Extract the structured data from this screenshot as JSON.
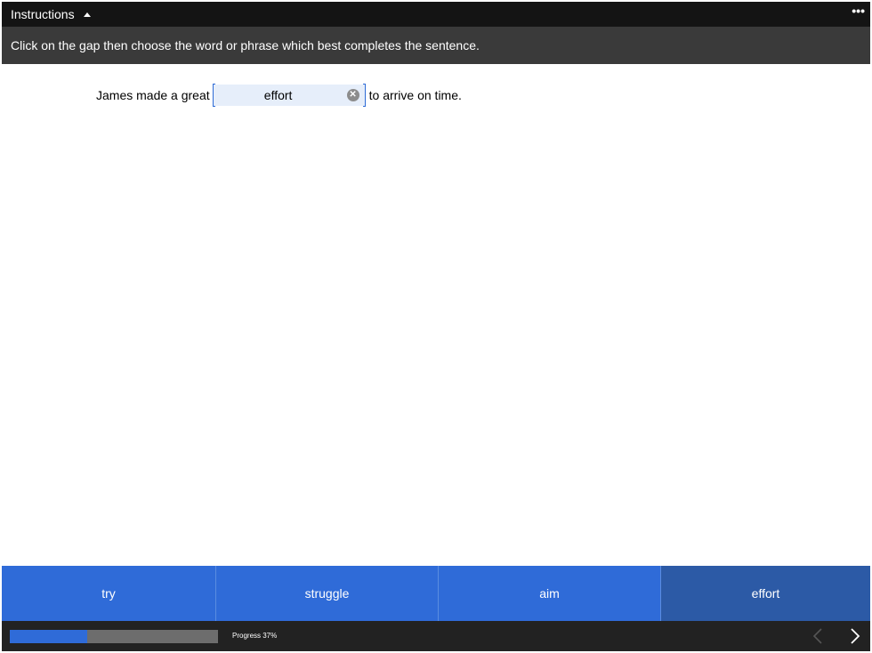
{
  "header": {
    "instructions_label": "Instructions",
    "more_label": "•••"
  },
  "instructions": {
    "text": "Click on the gap then choose the word or phrase which best completes the sentence."
  },
  "question": {
    "before": "James made a great",
    "gap_value": "effort",
    "after": "to arrive on time."
  },
  "options": [
    {
      "label": "try",
      "used": false
    },
    {
      "label": "struggle",
      "used": false
    },
    {
      "label": "aim",
      "used": false
    },
    {
      "label": "effort",
      "used": true
    }
  ],
  "footer": {
    "progress_label": "Progress 37%",
    "progress_fraction": 0.37
  },
  "colors": {
    "accent": "#2f6bd8",
    "used_option": "#2c5aa6",
    "topbar": "#141414",
    "instruction_bar": "#3a3a3a"
  },
  "icons": [
    "caret-up-icon",
    "more-icon",
    "clear-icon",
    "chevron-left-icon",
    "chevron-right-icon"
  ]
}
